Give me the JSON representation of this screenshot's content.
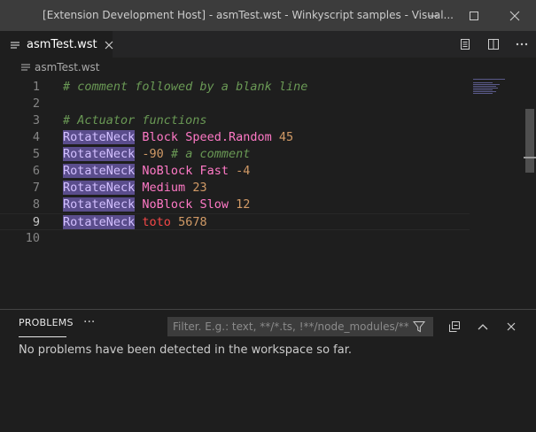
{
  "window": {
    "title": "[Extension Development Host] - asmTest.wst - Winkyscript samples - Visual..."
  },
  "tab": {
    "label": "asmTest.wst"
  },
  "breadcrumb": {
    "file": "asmTest.wst"
  },
  "editor": {
    "lines": [
      {
        "num": "1",
        "tokens": [
          {
            "t": "comment",
            "v": "# comment followed by a blank line"
          }
        ]
      },
      {
        "num": "2",
        "tokens": []
      },
      {
        "num": "3",
        "tokens": [
          {
            "t": "comment",
            "v": "# Actuator functions"
          }
        ]
      },
      {
        "num": "4",
        "tokens": [
          {
            "t": "cmd",
            "v": "RotateNeck"
          },
          {
            "t": "plain",
            "v": " "
          },
          {
            "t": "kw",
            "v": "Block Speed.Random"
          },
          {
            "t": "plain",
            "v": " "
          },
          {
            "t": "num",
            "v": "45"
          }
        ]
      },
      {
        "num": "5",
        "tokens": [
          {
            "t": "cmd",
            "v": "RotateNeck"
          },
          {
            "t": "plain",
            "v": " "
          },
          {
            "t": "num",
            "v": "-90"
          },
          {
            "t": "plain",
            "v": " "
          },
          {
            "t": "comment",
            "v": "# a comment"
          }
        ]
      },
      {
        "num": "6",
        "tokens": [
          {
            "t": "cmd",
            "v": "RotateNeck"
          },
          {
            "t": "plain",
            "v": " "
          },
          {
            "t": "kw",
            "v": "NoBlock Fast"
          },
          {
            "t": "plain",
            "v": " "
          },
          {
            "t": "num",
            "v": "-4"
          }
        ]
      },
      {
        "num": "7",
        "tokens": [
          {
            "t": "cmd",
            "v": "RotateNeck"
          },
          {
            "t": "plain",
            "v": " "
          },
          {
            "t": "kw",
            "v": "Medium"
          },
          {
            "t": "plain",
            "v": " "
          },
          {
            "t": "num",
            "v": "23"
          }
        ]
      },
      {
        "num": "8",
        "tokens": [
          {
            "t": "cmd",
            "v": "RotateNeck"
          },
          {
            "t": "plain",
            "v": " "
          },
          {
            "t": "kw",
            "v": "NoBlock Slow"
          },
          {
            "t": "plain",
            "v": " "
          },
          {
            "t": "num",
            "v": "12"
          }
        ]
      },
      {
        "num": "9",
        "tokens": [
          {
            "t": "cmd",
            "v": "RotateNeck"
          },
          {
            "t": "plain",
            "v": " "
          },
          {
            "t": "err",
            "v": "toto"
          },
          {
            "t": "plain",
            "v": " "
          },
          {
            "t": "num",
            "v": "5678"
          }
        ]
      },
      {
        "num": "10",
        "tokens": []
      }
    ],
    "current_line": "9"
  },
  "panel": {
    "tab_label": "PROBLEMS",
    "more_label": "···",
    "filter_placeholder": "Filter. E.g.: text, **/*.ts, !**/node_modules/**",
    "message": "No problems have been detected in the workspace so far."
  },
  "icons": {
    "minimize": "minimize-icon",
    "maximize": "maximize-icon",
    "close": "close-icon",
    "tab_close": "close-icon",
    "file": "file-icon",
    "preview": "open-preview-icon",
    "split": "split-editor-icon",
    "more": "more-actions-icon",
    "filter": "filter-icon",
    "collapse_all": "collapse-all-icon",
    "panel_maximize": "chevron-up-icon",
    "panel_close": "close-icon"
  },
  "colors": {
    "comment": "#6a9955",
    "command_bg": "#5a4d8c",
    "keyword": "#ff79c6",
    "number": "#d19a66",
    "error": "#f44747"
  }
}
